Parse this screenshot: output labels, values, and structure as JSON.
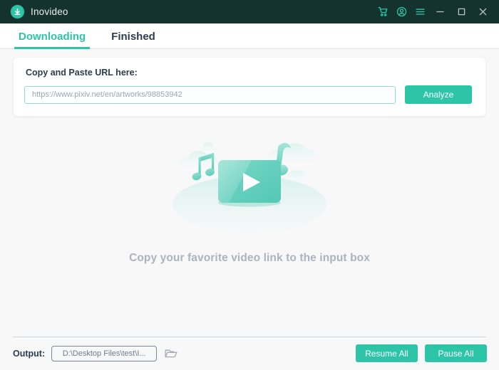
{
  "window": {
    "app_title": "Inovideo",
    "logo_icon": "download-circle-icon",
    "titlebar_color": "#14332F",
    "accent_color": "#2EC4A8",
    "controls": [
      {
        "name": "cart-icon",
        "tooltip": "Cart"
      },
      {
        "name": "account-icon",
        "tooltip": "Account"
      },
      {
        "name": "menu-icon",
        "tooltip": "Menu"
      },
      {
        "name": "minimize-icon",
        "tooltip": "Minimize"
      },
      {
        "name": "maximize-icon",
        "tooltip": "Maximize"
      },
      {
        "name": "close-icon",
        "tooltip": "Close"
      }
    ]
  },
  "tabs": [
    {
      "label": "Downloading",
      "active": true
    },
    {
      "label": "Finished",
      "active": false
    }
  ],
  "url_panel": {
    "label": "Copy and Paste URL here:",
    "input_value": "",
    "input_placeholder": "https://www.pixiv.net/en/artworks/98853942",
    "analyze_label": "Analyze"
  },
  "empty_state": {
    "message": "Copy your favorite video link to the input box",
    "illustration": "video-player-with-music-notes-illustration"
  },
  "bottom_bar": {
    "output_label": "Output:",
    "output_path": "D:\\Desktop Files\\test\\I...",
    "folder_icon": "folder-icon",
    "resume_all_label": "Resume All",
    "pause_all_label": "Pause All"
  }
}
